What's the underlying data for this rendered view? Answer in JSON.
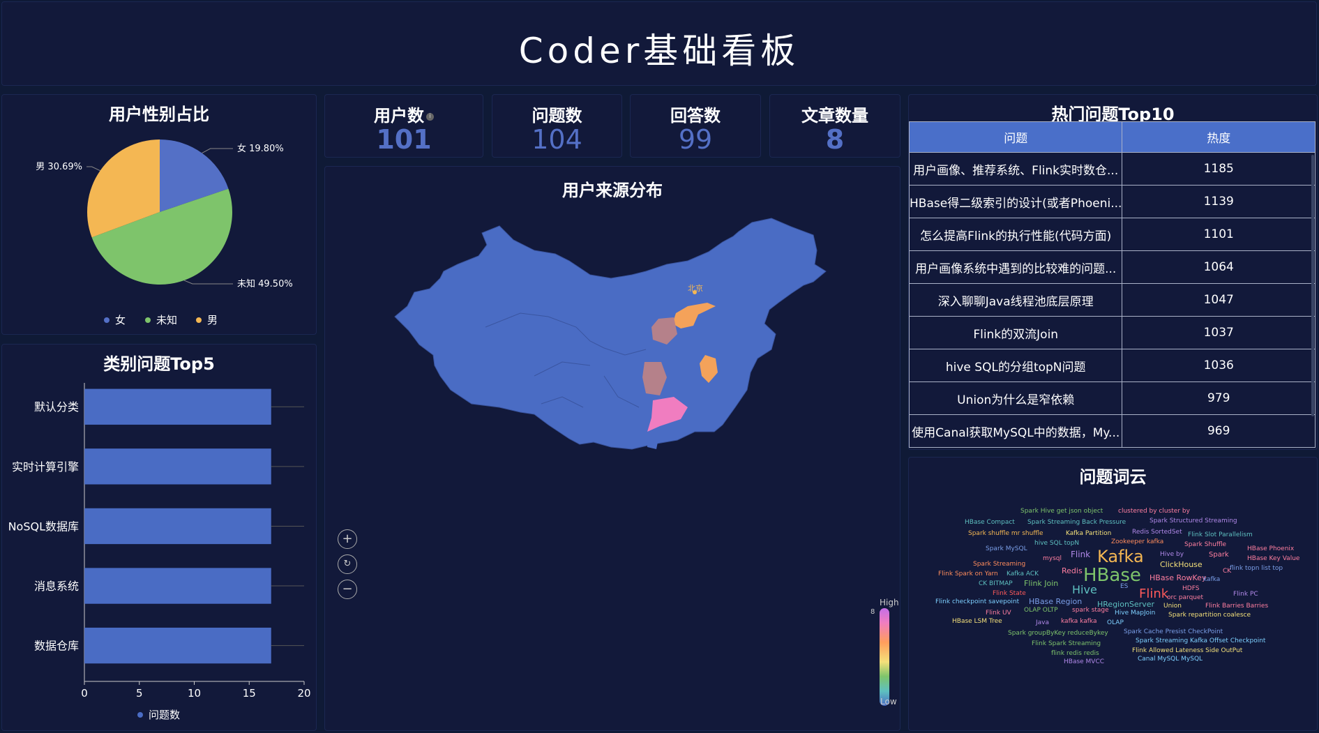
{
  "header": {
    "title": "Coder基础看板"
  },
  "gender": {
    "title": "用户性别占比",
    "chart_data": {
      "type": "pie",
      "slices": [
        {
          "name": "女",
          "value": 19.8,
          "label": "女 19.80%",
          "color": "#5470c6"
        },
        {
          "name": "未知",
          "value": 49.5,
          "label": "未知 49.50%",
          "color": "#7ec46b"
        },
        {
          "name": "男",
          "value": 30.69,
          "label": "男 30.69%",
          "color": "#f4b753"
        }
      ],
      "legend": [
        "女",
        "未知",
        "男"
      ]
    }
  },
  "stats": {
    "users": {
      "title": "用户数",
      "value": "101"
    },
    "questions": {
      "title": "问题数",
      "value": "104"
    },
    "answers": {
      "title": "回答数",
      "value": "99"
    },
    "articles": {
      "title": "文章数量",
      "value": "8"
    }
  },
  "category": {
    "title": "类别问题Top5",
    "chart_data": {
      "type": "bar",
      "orientation": "horizontal",
      "categories": [
        "默认分类",
        "实时计算引擎",
        "NoSQL数据库",
        "消息系统",
        "数据仓库"
      ],
      "series": [
        {
          "name": "问题数",
          "values": [
            17,
            17,
            17,
            17,
            17
          ]
        }
      ],
      "xlim": [
        0,
        20
      ],
      "xticks": [
        "0",
        "5",
        "10",
        "15",
        "20"
      ],
      "color": "#4a6cc4"
    }
  },
  "map": {
    "title": "用户来源分布",
    "city_label": "北京",
    "visual": {
      "high": "High",
      "low": "Low",
      "max": "8"
    }
  },
  "hot": {
    "title": "热门问题Top10",
    "columns": [
      "问题",
      "热度"
    ],
    "rows": [
      [
        "用户画像、推荐系统、Flink实时数仓...",
        "1185"
      ],
      [
        "HBase得二级索引的设计(或者Phoeni...",
        "1139"
      ],
      [
        "怎么提高Flink的执行性能(代码方面)",
        "1101"
      ],
      [
        "用户画像系统中遇到的比较难的问题...",
        "1064"
      ],
      [
        "深入聊聊Java线程池底层原理",
        "1047"
      ],
      [
        "Flink的双流Join",
        "1037"
      ],
      [
        "hive SQL的分组topN问题",
        "1036"
      ],
      [
        "Union为什么是窄依赖",
        "979"
      ],
      [
        "使用Canal获取MySQL中的数据，My...",
        "969"
      ]
    ]
  },
  "cloud": {
    "title": "问题词云",
    "words": [
      {
        "t": "Spark Hive get json object",
        "c": "#7ec46b",
        "s": 9
      },
      {
        "t": "clustered by cluster by",
        "c": "#ff7fa0",
        "s": 9
      },
      {
        "t": "HBase Compact",
        "c": "#5ec0c0",
        "s": 9
      },
      {
        "t": "Spark Streaming Back Pressure",
        "c": "#5ec0c0",
        "s": 9
      },
      {
        "t": "Spark Structured Streaming",
        "c": "#b088e8",
        "s": 9
      },
      {
        "t": "Redis SortedSet",
        "c": "#b088e8",
        "s": 9
      },
      {
        "t": "Spark shuffle mr shuffle",
        "c": "#f4b753",
        "s": 9
      },
      {
        "t": "Kafka Partition",
        "c": "#f4e07a",
        "s": 9
      },
      {
        "t": "Flink Slot Parallelism",
        "c": "#5ec0c0",
        "s": 9
      },
      {
        "t": "hive SQL topN",
        "c": "#5ec0c0",
        "s": 9
      },
      {
        "t": "Zookeeper kafka",
        "c": "#ff8c5c",
        "s": 9
      },
      {
        "t": "Spark MySQL",
        "c": "#7b9fe8",
        "s": 9
      },
      {
        "t": "Spark Shuffle",
        "c": "#ff7fa0",
        "s": 9
      },
      {
        "t": "HBase Phoenix",
        "c": "#ff7fa0",
        "s": 9
      },
      {
        "t": "Flink",
        "c": "#b088e8",
        "s": 12
      },
      {
        "t": "Kafka",
        "c": "#f4b753",
        "s": 24
      },
      {
        "t": "Hive by",
        "c": "#b088e8",
        "s": 9
      },
      {
        "t": "Spark",
        "c": "#ff7fa0",
        "s": 10
      },
      {
        "t": "HBase Key Value",
        "c": "#ff7fa0",
        "s": 9
      },
      {
        "t": "mysql",
        "c": "#ff7fa0",
        "s": 9
      },
      {
        "t": "Spark Streaming",
        "c": "#ff8c5c",
        "s": 9
      },
      {
        "t": "ClickHouse",
        "c": "#f4e07a",
        "s": 11
      },
      {
        "t": "CK",
        "c": "#ff7fa0",
        "s": 9
      },
      {
        "t": "flink topn list top",
        "c": "#7b9fe8",
        "s": 9
      },
      {
        "t": "Flink Spark on Yarn",
        "c": "#ff8c5c",
        "s": 9
      },
      {
        "t": "Kafka ACK",
        "c": "#5ec0c0",
        "s": 9
      },
      {
        "t": "Redis",
        "c": "#ff7fa0",
        "s": 11
      },
      {
        "t": "HBase",
        "c": "#7ec46b",
        "s": 26
      },
      {
        "t": "HBase RowKey",
        "c": "#ff7fa0",
        "s": 11
      },
      {
        "t": "kafka",
        "c": "#7b9fe8",
        "s": 9
      },
      {
        "t": "CK BITMAP",
        "c": "#5ec0c0",
        "s": 9
      },
      {
        "t": "Flink Join",
        "c": "#7ec46b",
        "s": 11
      },
      {
        "t": "Hive",
        "c": "#5ec0c0",
        "s": 16
      },
      {
        "t": "ES",
        "c": "#7b9fe8",
        "s": 9
      },
      {
        "t": "Flink",
        "c": "#ff5a5a",
        "s": 18
      },
      {
        "t": "HDFS",
        "c": "#ff7fa0",
        "s": 9
      },
      {
        "t": "Flink State",
        "c": "#ff5a5a",
        "s": 9
      },
      {
        "t": "Flink PC",
        "c": "#b088e8",
        "s": 9
      },
      {
        "t": "orc parquet",
        "c": "#ff7fa0",
        "s": 9
      },
      {
        "t": "Flink checkpoint savepoint",
        "c": "#7ed0ff",
        "s": 9
      },
      {
        "t": "HBase Region",
        "c": "#7b9fe8",
        "s": 11
      },
      {
        "t": "HRegionServer",
        "c": "#5ec0c0",
        "s": 11
      },
      {
        "t": "Union",
        "c": "#f4e07a",
        "s": 9
      },
      {
        "t": "Flink Barries Barries",
        "c": "#ff7fa0",
        "s": 9
      },
      {
        "t": "OLAP OLTP",
        "c": "#7ec46b",
        "s": 9
      },
      {
        "t": "spark stage",
        "c": "#ff7fa0",
        "s": 9
      },
      {
        "t": "Flink UV",
        "c": "#ff7fa0",
        "s": 9
      },
      {
        "t": "Hive MapJoin",
        "c": "#7ed0ff",
        "s": 9
      },
      {
        "t": "Spark repartition coalesce",
        "c": "#f4e07a",
        "s": 9
      },
      {
        "t": "HBase LSM Tree",
        "c": "#f4e07a",
        "s": 9
      },
      {
        "t": "Java",
        "c": "#b088e8",
        "s": 9
      },
      {
        "t": "kafka kafka",
        "c": "#ff7fa0",
        "s": 9
      },
      {
        "t": "OLAP",
        "c": "#7ed0ff",
        "s": 9
      },
      {
        "t": "Spark Cache Presist CheckPoint",
        "c": "#7b9fe8",
        "s": 9
      },
      {
        "t": "Spark groupByKey reduceBykey",
        "c": "#7ec46b",
        "s": 9
      },
      {
        "t": "Spark Streaming Kafka Offset Checkpoint",
        "c": "#7ed0ff",
        "s": 9
      },
      {
        "t": "Flink Spark Streaming",
        "c": "#7ec46b",
        "s": 9
      },
      {
        "t": "Flink Allowed Lateness Side OutPut",
        "c": "#f4e07a",
        "s": 9
      },
      {
        "t": "flink redis redis",
        "c": "#7ec46b",
        "s": 9
      },
      {
        "t": "HBase MVCC",
        "c": "#b088e8",
        "s": 9
      },
      {
        "t": "Canal MySQL MySQL",
        "c": "#7ed0ff",
        "s": 9
      }
    ]
  }
}
